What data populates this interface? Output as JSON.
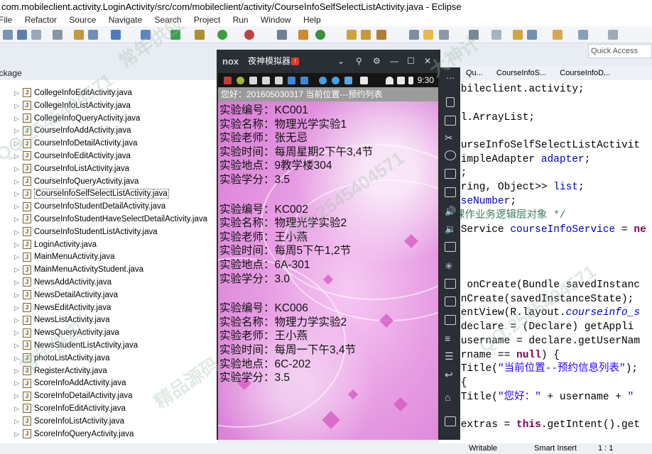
{
  "window": {
    "title": "com.mobileclient.activity.LoginActivity/src/com/mobileclient/activity/CourseInfoSelfSelectListActivity.java - Eclipse"
  },
  "menu": [
    "File",
    "Refactor",
    "Source",
    "Navigate",
    "Search",
    "Project",
    "Run",
    "Window",
    "Help"
  ],
  "quick_access": "Quick Access",
  "package_explorer": {
    "tab_label": "Package Explorer",
    "files": [
      "CollegeInfoEditActivity.java",
      "CollegeInfoListActivity.java",
      "CollegeInfoQueryActivity.java",
      "CourseInfoAddActivity.java",
      "CourseInfoDetailActivity.java",
      "CourseInfoEditActivity.java",
      "CourseInfoListActivity.java",
      "CourseInfoQueryActivity.java",
      "CourseInfoSelfSelectListActivity.java",
      "CourseInfoStudentDetailActivity.java",
      "CourseInfoStudentHaveSelectDetailActivity.java",
      "CourseInfoStudentListActivity.java",
      "LoginActivity.java",
      "MainMenuActivity.java",
      "MainMenuActivityStudent.java",
      "NewsAddActivity.java",
      "NewsDetailActivity.java",
      "NewsEditActivity.java",
      "NewsListActivity.java",
      "NewsQueryActivity.java",
      "NewsStudentListActivity.java",
      "photoListActivity.java",
      "RegisterActivity.java",
      "ScoreInfoAddActivity.java",
      "ScoreInfoDetailActivity.java",
      "ScoreInfoEditActivity.java",
      "ScoreInfoListActivity.java",
      "ScoreInfoQueryActivity.java"
    ],
    "selected": "CourseInfoSelfSelectListActivity.java"
  },
  "editor_tabs": [
    "Qu...",
    "CourseInfoS...",
    "CourseInfoD..."
  ],
  "emulator": {
    "app_name": "夜神模拟器",
    "logo": "nox",
    "badge": "!",
    "clock": "9:30",
    "greeting": "您好：201605030317  当前位置---预约列表",
    "courses": [
      {
        "lines": [
          "实验编号：KC001",
          "实验名称：物理光学实验1",
          "实验老师：张无忌",
          "实验时间：每周星期2下午3,4节",
          "实验地点：9教学楼304",
          "实验学分：3.5"
        ]
      },
      {
        "lines": [
          "实验编号：KC002",
          "实验名称：物理光学实验2",
          "实验老师：王小燕",
          "实验时间：每周5下午1,2节",
          "实验地点：6A-301",
          "实验学分：3.0"
        ]
      },
      {
        "lines": [
          "实验编号：KC006",
          "实验名称：物理力学实验2",
          "实验老师：王小燕",
          "实验时间：每周一下午3,4节",
          "实验地点：6C-202",
          "实验学分：3.5"
        ]
      }
    ]
  },
  "status": {
    "writable": "Writable",
    "insert": "Smart Insert",
    "pos": "1 : 1"
  },
  "watermark": [
    "QQ:2545404571",
    "常年供应",
    "大神计",
    "精品源码"
  ]
}
